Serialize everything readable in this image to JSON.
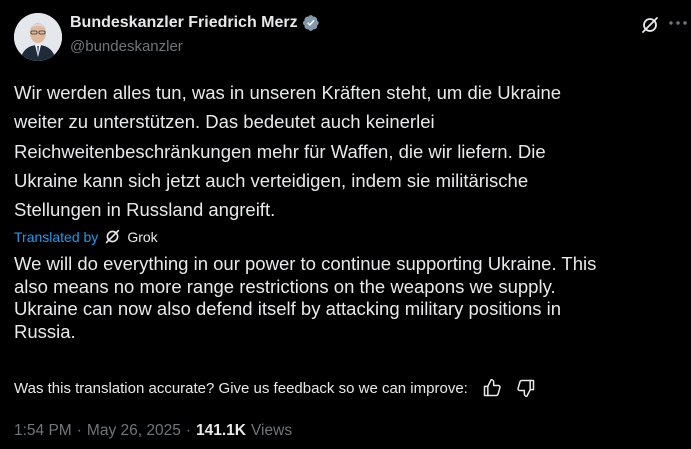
{
  "author": {
    "display_name": "Bundeskanzler Friedrich Merz",
    "handle": "@bundeskanzler",
    "verified": true,
    "verified_color": "#829aab"
  },
  "icons": {
    "grok": "grok-icon",
    "more": "more-dots-icon",
    "thumbs_up": "thumbs-up-icon",
    "thumbs_down": "thumbs-down-icon"
  },
  "post": {
    "original_lines": [
      "Wir werden alles tun, was in unseren Kräften steht, um die Ukraine",
      "weiter zu unterstützen. Das bedeutet auch keinerlei",
      "Reichweitenbeschränkungen mehr für Waffen, die wir liefern. Die",
      "Ukraine kann sich jetzt auch verteidigen, indem sie militärische",
      "Stellungen in Russland angreift."
    ],
    "translated_by_label": "Translated by",
    "translator": "Grok",
    "translation_lines": [
      "We will do everything in our power to continue supporting Ukraine. This",
      "also means no more range restrictions on the weapons we supply.",
      "Ukraine can now also defend itself by attacking military positions in",
      "Russia."
    ],
    "feedback_prompt": "Was this translation accurate? Give us feedback so we can improve:"
  },
  "meta": {
    "time": "1:54 PM",
    "separator": "·",
    "date": "May 26, 2025",
    "views_count": "141.1K",
    "views_label": "Views"
  },
  "colors": {
    "background": "#000000",
    "text": "#e7e9ea",
    "secondary": "#71767b",
    "link": "#1d9bf0"
  }
}
